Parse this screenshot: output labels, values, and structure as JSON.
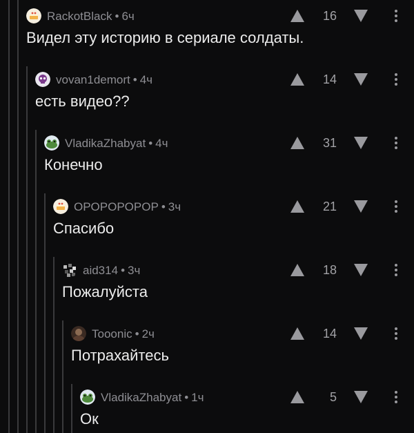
{
  "comments": [
    {
      "author": "RackotBlack",
      "time": "6ч",
      "score": "16",
      "text": "Видел эту историю в сериале солдаты.",
      "avatar": "cake-icon"
    },
    {
      "author": "vovan1demort",
      "time": "4ч",
      "score": "14",
      "text": "есть видео??",
      "avatar": "skull-icon"
    },
    {
      "author": "VladikaZhabyat",
      "time": "4ч",
      "score": "31",
      "text": "Конечно",
      "avatar": "frog-icon"
    },
    {
      "author": "OPOPOPOPOP",
      "time": "3ч",
      "score": "21",
      "text": "Спасибо",
      "avatar": "cake-icon"
    },
    {
      "author": "aid314",
      "time": "3ч",
      "score": "18",
      "text": "Пожалуйста",
      "avatar": "pixel-icon"
    },
    {
      "author": "Tooonic",
      "time": "2ч",
      "score": "14",
      "text": "Потрахайтесь",
      "avatar": "dark-avatar-icon"
    },
    {
      "author": "VladikaZhabyat",
      "time": "1ч",
      "score": "5",
      "text": "Ок",
      "avatar": "frog-icon"
    }
  ],
  "separator": "•",
  "colors": {
    "background": "#0c0c0d",
    "thread_line": "#3a3a3c",
    "meta": "#8e8e93",
    "text": "#ececec",
    "icon": "#9a9a9e"
  }
}
